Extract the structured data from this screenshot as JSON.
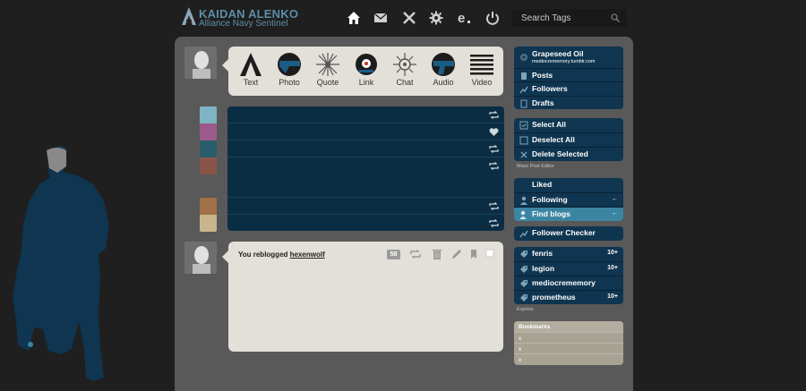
{
  "header": {
    "logo_title": "KAIDAN ALENKO",
    "logo_subtitle": "Alliance Navy Sentinel",
    "nav_icons": [
      "home-icon",
      "mail-icon",
      "xkit-icon",
      "gear-icon",
      "edit-icon",
      "power-icon"
    ],
    "search_placeholder": "Search Tags"
  },
  "post_types": [
    {
      "label": "Text",
      "icon": "text-icon"
    },
    {
      "label": "Photo",
      "icon": "photo-icon"
    },
    {
      "label": "Quote",
      "icon": "quote-icon"
    },
    {
      "label": "Link",
      "icon": "link-icon"
    },
    {
      "label": "Chat",
      "icon": "chat-icon"
    },
    {
      "label": "Audio",
      "icon": "audio-icon"
    },
    {
      "label": "Video",
      "icon": "video-icon"
    }
  ],
  "activity_icons": [
    "reblog-icon",
    "heart-icon",
    "reblog-icon",
    "reblog-icon",
    "reblog-icon",
    "reblog-icon"
  ],
  "post": {
    "prefix": "You reblogged",
    "user": "hexenwolf",
    "count": "58"
  },
  "sidebar": {
    "blog": {
      "name": "Grapeseed Oil",
      "url": "mediocrememory.tumblr.com"
    },
    "blog_links": [
      "Posts",
      "Followers",
      "Drafts"
    ],
    "mass_actions": [
      "Select All",
      "Deselect All",
      "Delete Selected"
    ],
    "mass_note": "Mass Post Editor",
    "social": [
      {
        "label": "Liked",
        "arrow": ""
      },
      {
        "label": "Following",
        "arrow": "←"
      },
      {
        "label": "Find blogs",
        "arrow": "←"
      }
    ],
    "checker": "Follower Checker",
    "tags": [
      {
        "label": "fenris",
        "count": "10+"
      },
      {
        "label": "legion",
        "count": "10+"
      },
      {
        "label": "mediocrememory",
        "count": ""
      },
      {
        "label": "prometheus",
        "count": "10+"
      }
    ],
    "explore": "Explore",
    "bookmarks": {
      "title": "Bookmarks",
      "items": [
        "x",
        "x",
        "x"
      ]
    }
  },
  "colors": {
    "accent": "#0f3550",
    "highlight": "#3c85a2",
    "activity": "#0b2d44",
    "card": "#e3e0d9",
    "dashboard": "#595959"
  }
}
